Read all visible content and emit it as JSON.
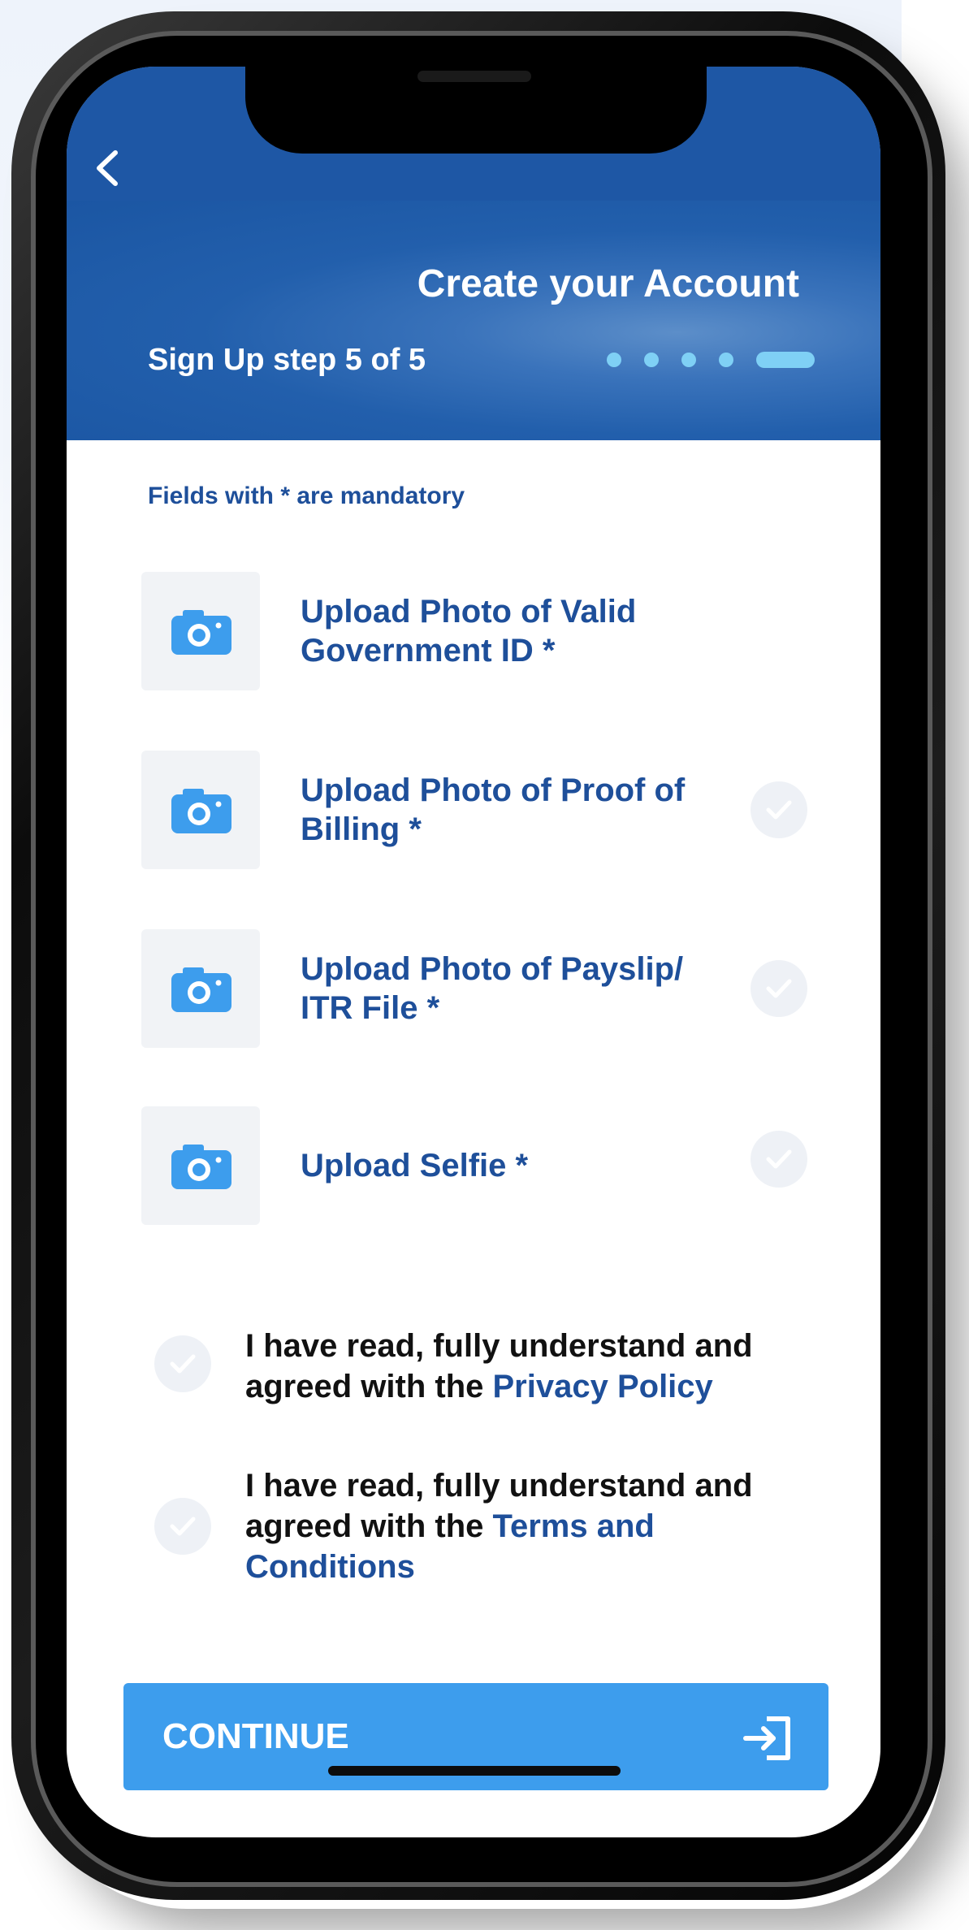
{
  "header": {
    "back_glyph": "‹",
    "title": "Create your Account",
    "step_text": "Sign Up step 5 of 5",
    "step_total": 5,
    "step_current": 5
  },
  "form": {
    "note": "Fields with * are mandatory",
    "uploads": [
      {
        "line1": "Upload Photo of Valid",
        "line2": "Government ID *",
        "icon": "camera-icon",
        "has_check": false
      },
      {
        "line1": "Upload Photo of Proof of",
        "line2": "Billing *",
        "icon": "camera-icon",
        "has_check": true
      },
      {
        "line1": "Upload Photo of Payslip/",
        "line2": "ITR File *",
        "icon": "camera-icon",
        "has_check": true
      },
      {
        "line1": "Upload Selfie *",
        "line2": "",
        "icon": "camera-icon",
        "has_check": true
      }
    ],
    "agreements": [
      {
        "line1": "I have read, fully understand and",
        "prefix": "agreed with the ",
        "link": "Privacy Policy",
        "link2": ""
      },
      {
        "line1": "I have read, fully understand and",
        "prefix": "agreed with the ",
        "link": "Terms and",
        "link2": "Conditions"
      }
    ]
  },
  "continue": {
    "label": "CONTINUE",
    "icon": "enter-icon"
  },
  "colors": {
    "header_blue": "#1e57a5",
    "text_blue": "#1e4f9a",
    "button_blue": "#3d9ded",
    "step_dot": "#7fd0f5"
  }
}
